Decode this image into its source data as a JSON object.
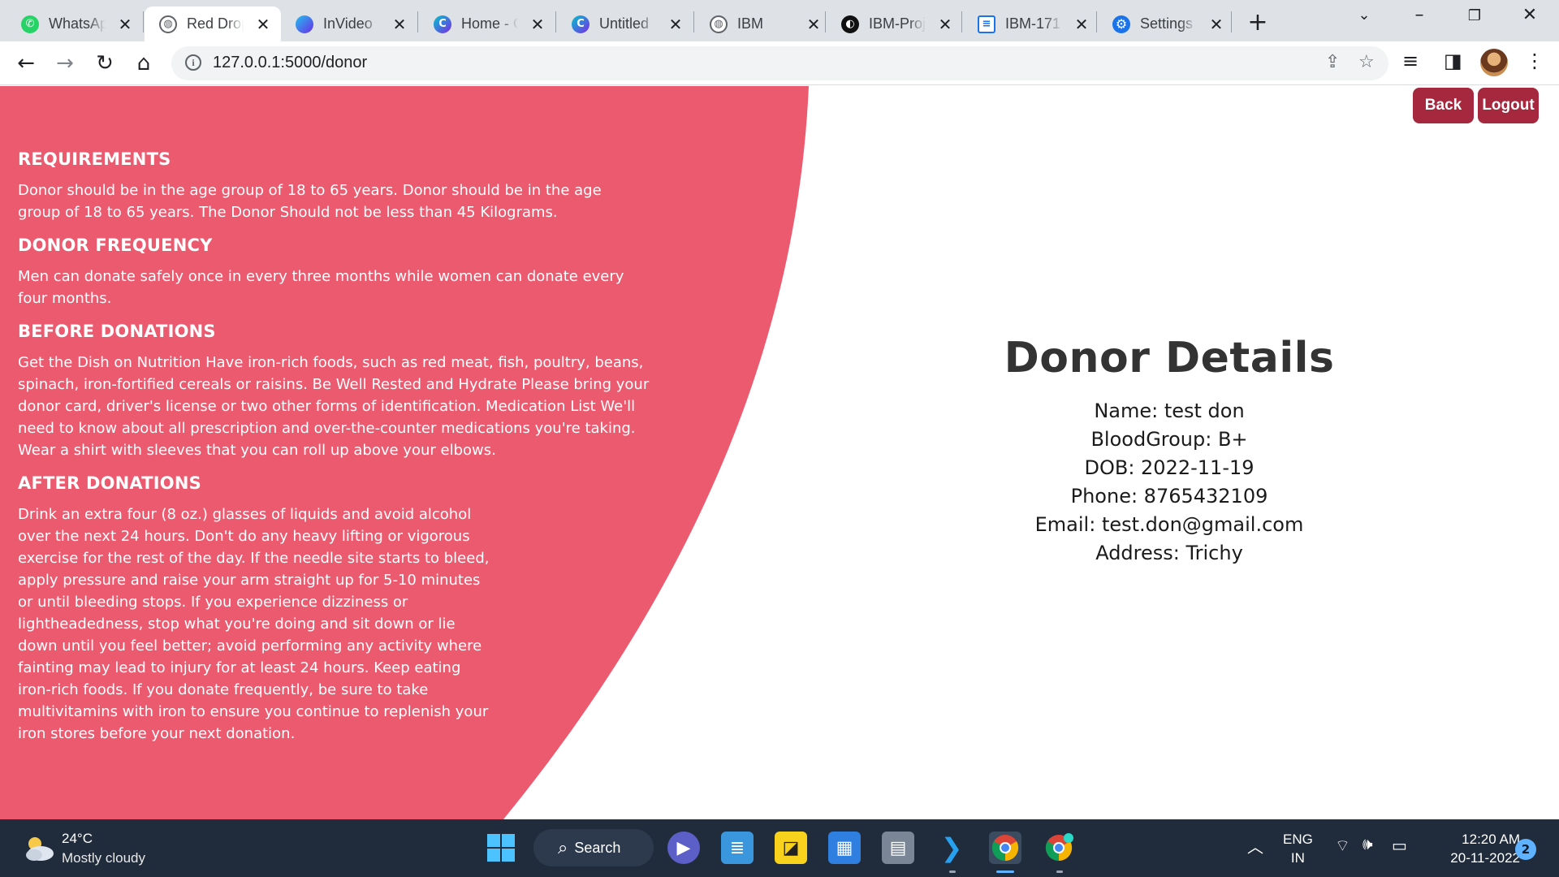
{
  "browser": {
    "tabs": [
      {
        "title": "WhatsApp",
        "icon": "whatsapp-icon",
        "color": "#25d366",
        "active": false
      },
      {
        "title": "Red Drop",
        "icon": "globe-icon",
        "color": "#5f6368",
        "active": true
      },
      {
        "title": "InVideo",
        "icon": "invideo-icon",
        "color": "#3b82f6",
        "active": false
      },
      {
        "title": "Home - Canva",
        "icon": "canva-icon",
        "color": "#7d2ae8",
        "active": false
      },
      {
        "title": "Untitled",
        "icon": "canva-icon",
        "color": "#7d2ae8",
        "active": false
      },
      {
        "title": "IBM",
        "icon": "globe-icon",
        "color": "#5f6368",
        "active": false
      },
      {
        "title": "IBM-Project",
        "icon": "github-icon",
        "color": "#000000",
        "active": false
      },
      {
        "title": "IBM-171",
        "icon": "document-icon",
        "color": "#1a73e8",
        "active": false
      },
      {
        "title": "Settings",
        "icon": "gear-icon",
        "color": "#1a73e8",
        "active": false
      }
    ],
    "url": "127.0.0.1:5000/donor"
  },
  "page": {
    "accent_color": "#eb5a6f",
    "button_color": "#a5283e",
    "nav": {
      "back": "Back",
      "logout": "Logout"
    },
    "sections": [
      {
        "heading": "REQUIREMENTS",
        "text": "Donor should be in the age group of 18 to 65 years. Donor should be in the age group of 18 to 65 years. The Donor Should not be less than 45 Kilograms."
      },
      {
        "heading": "DONOR FREQUENCY",
        "text": "Men can donate safely once in every three months while women can donate every four months."
      },
      {
        "heading": "BEFORE DONATIONS",
        "text": "Get the Dish on Nutrition Have iron-rich foods, such as red meat, fish, poultry, beans, spinach, iron-fortified cereals or raisins. Be Well Rested and Hydrate Please bring your donor card, driver's license or two other forms of identification. Medication List We'll need to know about all prescription and over-the-counter medications you're taking. Wear a shirt with sleeves that you can roll up above your elbows."
      },
      {
        "heading": "AFTER DONATIONS",
        "text": "Drink an extra four (8 oz.) glasses of liquids and avoid alcohol over the next 24 hours. Don't do any heavy lifting or vigorous exercise for the rest of the day. If the needle site starts to bleed, apply pressure and raise your arm straight up for 5-10 minutes or until bleeding stops. If you experience dizziness or lightheadedness, stop what you're doing and sit down or lie down until you feel better; avoid performing any activity where fainting may lead to injury for at least 24 hours. Keep eating iron-rich foods. If you donate frequently, be sure to take multivitamins with iron to ensure you continue to replenish your iron stores before your next donation."
      }
    ],
    "details": {
      "title": "Donor Details",
      "name": "Name: test don",
      "blood_group": "BloodGroup: B+",
      "dob": "DOB: 2022-11-19",
      "phone": "Phone: 8765432109",
      "email": "Email: test.don@gmail.com",
      "address": "Address: Trichy"
    }
  },
  "taskbar": {
    "weather_temp": "24°C",
    "weather_desc": "Mostly cloudy",
    "search_label": "Search",
    "lang_line1": "ENG",
    "lang_line2": "IN",
    "time": "12:20 AM",
    "date": "20-11-2022",
    "notifications": "2"
  }
}
